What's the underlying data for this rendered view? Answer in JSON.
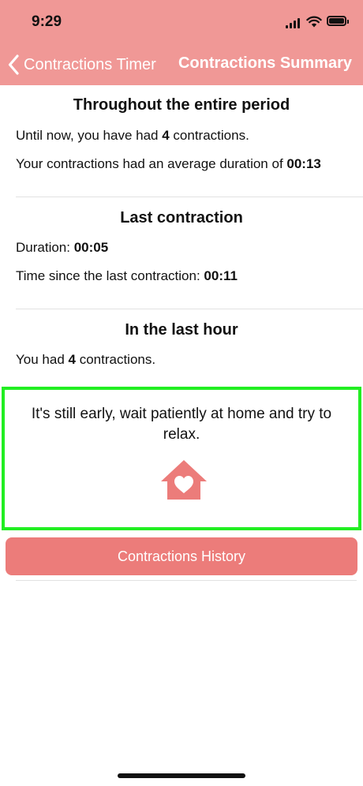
{
  "status_bar": {
    "time": "9:29"
  },
  "nav": {
    "back_label": "Contractions Timer",
    "title": "Contractions Summary"
  },
  "entire_period": {
    "title": "Throughout the entire period",
    "count_prefix": "Until now, you have had ",
    "count_value": "4",
    "count_suffix": " contractions.",
    "avg_prefix": "Your contractions had an average duration of ",
    "avg_value": "00:13"
  },
  "last_contraction": {
    "title": "Last contraction",
    "duration_label": "Duration: ",
    "duration_value": "00:05",
    "since_label": "Time since the last contraction: ",
    "since_value": "00:11"
  },
  "last_hour": {
    "title": "In the last hour",
    "prefix": "You had ",
    "value": "4",
    "suffix": " contractions."
  },
  "advice": {
    "text": "It's still early, wait patiently at home and try to relax.",
    "icon": "house-heart-icon"
  },
  "history_button": {
    "label": "Contractions History"
  },
  "colors": {
    "header": "#f09896",
    "button": "#ec7c7a",
    "icon": "#ec7c7a",
    "highlight": "#22ee22"
  }
}
